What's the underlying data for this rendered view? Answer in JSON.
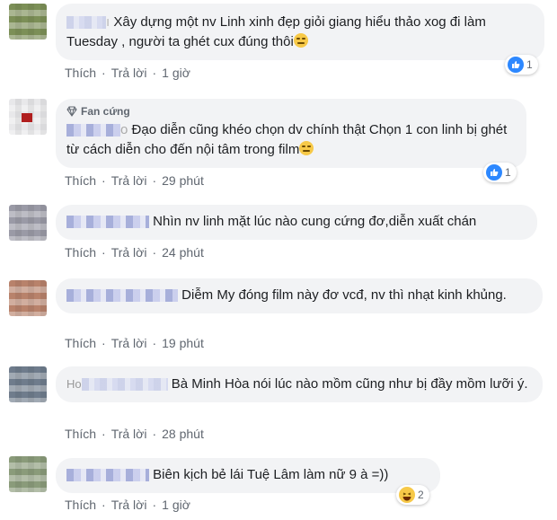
{
  "labels": {
    "like": "Thích",
    "reply": "Trả lời",
    "dot": "·"
  },
  "comments": [
    {
      "name_partial": "ı",
      "text": "Xây dựng một nv Linh xinh đẹp giỏi giang hiểu thảo xog đi làm Tuesday , người ta ghét cux đúng thôi",
      "time": "1 giờ",
      "reaction": {
        "icon": "like-icon",
        "count": "1"
      },
      "avatar_color": "#7c8f57"
    },
    {
      "badge": "Fan cứng",
      "name_partial": "o",
      "text": "Đạo diễn cũng khéo chọn dv chính thật Chọn 1 con linh bị ghét từ cách diễn cho đến nội tâm trong film",
      "time": "29 phút",
      "reaction": {
        "icon": "like-icon",
        "count": "1"
      },
      "avatar_color": "#b01e1e"
    },
    {
      "text": "Nhìn nv linh mặt lúc nào cung cứng đơ,diễn xuất chán",
      "time": "24 phút",
      "avatar_color": "#9a9aa6"
    },
    {
      "text": "Diễm My đóng film này đơ vcđ, nv thì nhạt kinh khủng.",
      "time": "19 phút",
      "avatar_color": "#b8826b"
    },
    {
      "name_partial": "Ho",
      "text": "Bà Minh Hòa nói lúc nào mồm cũng như bị đầy mồm lưỡi ý.",
      "time": "28 phút",
      "avatar_color": "#6f7c8c"
    },
    {
      "text": "Biên kịch bẻ lái Tuệ Lâm làm nữ 9 à =))",
      "time": "1 giờ",
      "reaction": {
        "icon": "haha-icon",
        "count": "2"
      },
      "avatar_color": "#8a9b7a"
    }
  ]
}
